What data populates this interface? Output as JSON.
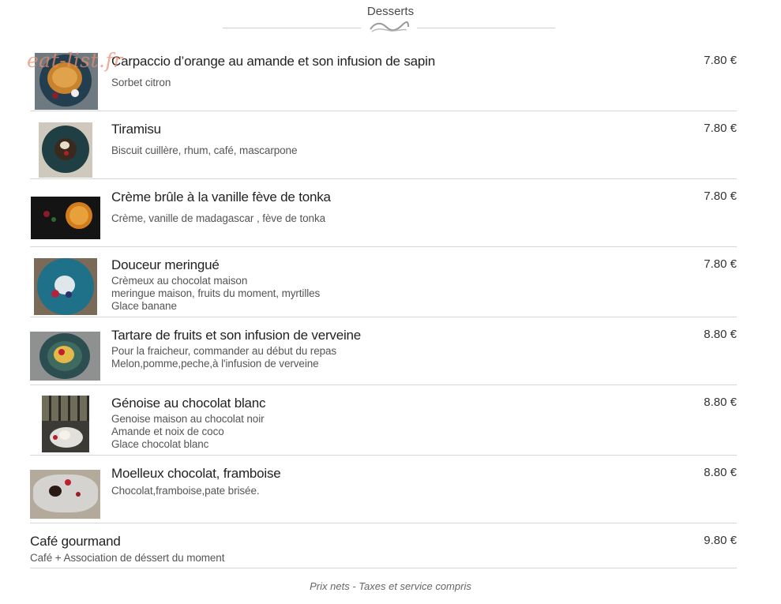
{
  "section": {
    "title": "Desserts"
  },
  "watermark": "eat-list.fr",
  "items": [
    {
      "name": "Carpaccio d’orange au amande et son infusion de sapin",
      "desc": "Sorbet citron",
      "price": "7.80 €",
      "icon": "carpaccio-photo"
    },
    {
      "name": "Tiramisu",
      "desc": "Biscuit cuillère, rhum, café, mascarpone",
      "price": "7.80 €",
      "icon": "tiramisu-photo"
    },
    {
      "name": "Crème brûle à la vanille fève de tonka",
      "desc": "Crème, vanille de madagascar , fève de tonka",
      "price": "7.80 €",
      "icon": "creme-brulee-photo"
    },
    {
      "name": "Douceur meringué",
      "desc": "Crèmeux au chocolat maison\nmeringue maison, fruits du moment, myrtilles\nGlace banane",
      "price": "7.80 €",
      "icon": "meringue-photo"
    },
    {
      "name": "Tartare de fruits et son infusion de verveine",
      "desc": "Pour la fraicheur, commander au début du repas\nMelon,pomme,peche,à l'infusion de verveine",
      "price": "8.80 €",
      "icon": "tartare-photo"
    },
    {
      "name": "Génoise au chocolat blanc",
      "desc": "Genoise maison au chocolat noir\nAmande et noix de coco\nGlace chocolat blanc",
      "price": "8.80 €",
      "icon": "genoise-photo"
    },
    {
      "name": "Moelleux chocolat, framboise",
      "desc": "Chocolat,framboise,pate brisée.",
      "price": "8.80 €",
      "icon": "moelleux-photo"
    },
    {
      "name": "Café gourmand",
      "desc": "Café + Association de déssert du moment",
      "price": "9.80 €"
    }
  ],
  "footer": "Prix nets - Taxes et service compris"
}
